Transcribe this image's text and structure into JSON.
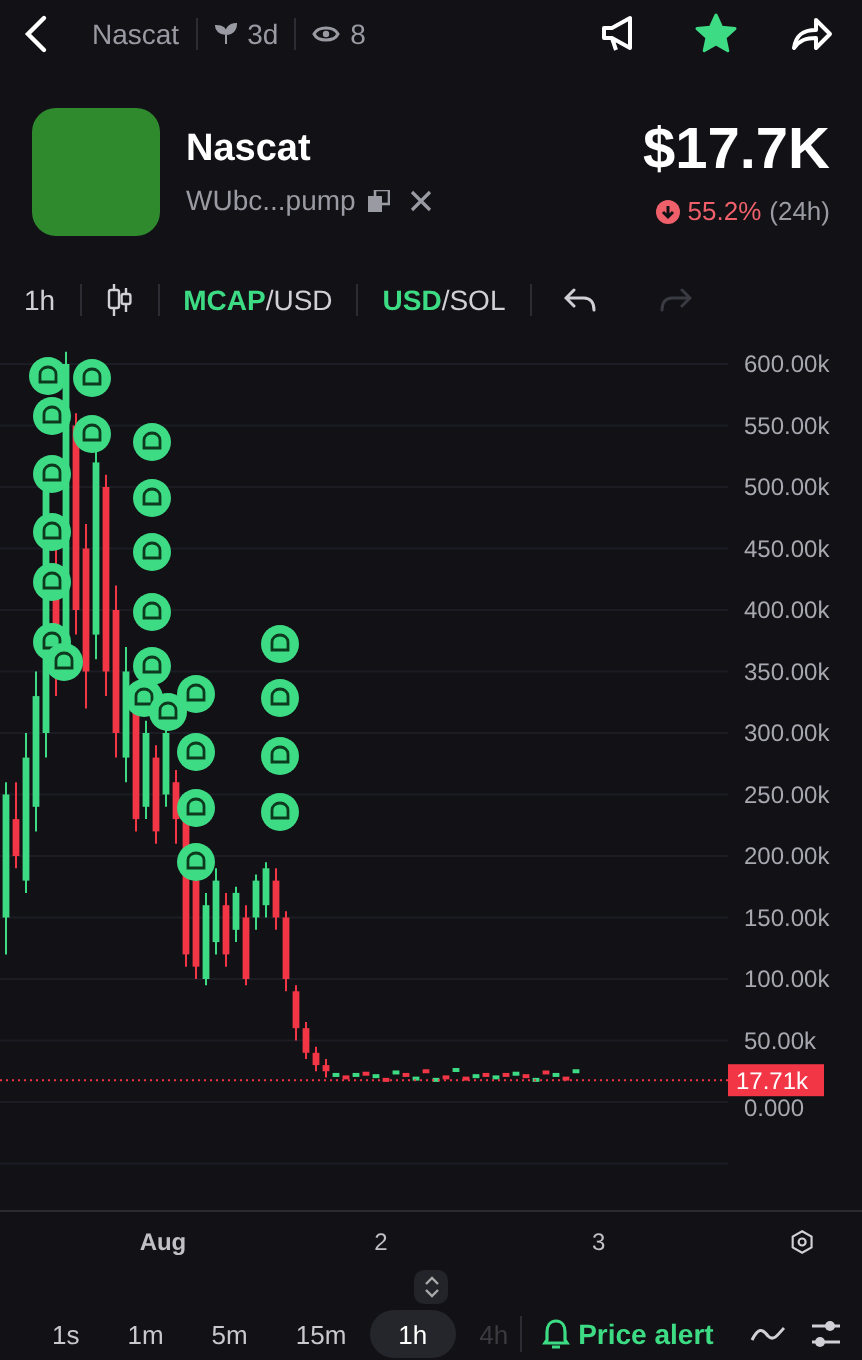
{
  "top_bar": {
    "title": "Nascat",
    "age": "3d",
    "watchers": "8",
    "favorited": true
  },
  "token": {
    "name": "Nascat",
    "address": "WUbc...pump",
    "market_cap": "$17.7K",
    "change": "55.2%",
    "falling": true,
    "change_period": "(24h)"
  },
  "toolbar": {
    "interval": "1h",
    "value_toggle": {
      "separator": "/",
      "options": [
        {
          "label": "MCAP",
          "selected": true
        },
        {
          "label": "USD",
          "selected": false
        }
      ]
    },
    "currency_toggle": {
      "separator": "/",
      "options": [
        {
          "label": "USD",
          "selected": true
        },
        {
          "label": "SOL",
          "selected": false
        }
      ]
    },
    "undo_disabled": false,
    "redo_disabled": true
  },
  "chart": {
    "y_axis_labels": [
      "600.00k",
      "550.00k",
      "500.00k",
      "450.00k",
      "400.00k",
      "350.00k",
      "300.00k",
      "250.00k",
      "200.00k",
      "150.00k",
      "100.00k",
      "50.00k",
      "0.000"
    ],
    "x_axis_labels": [
      "Aug",
      "2",
      "3"
    ],
    "current_price": "17.71k"
  },
  "intervals": [
    {
      "label": "1s",
      "selected": false,
      "faded": false
    },
    {
      "label": "1m",
      "selected": false,
      "faded": false
    },
    {
      "label": "5m",
      "selected": false,
      "faded": false
    },
    {
      "label": "15m",
      "selected": false,
      "faded": false
    },
    {
      "label": "1h",
      "selected": true,
      "faded": false
    },
    {
      "label": "4h",
      "selected": false,
      "faded": true
    }
  ],
  "price_alert": {
    "label": "Price alert"
  }
}
